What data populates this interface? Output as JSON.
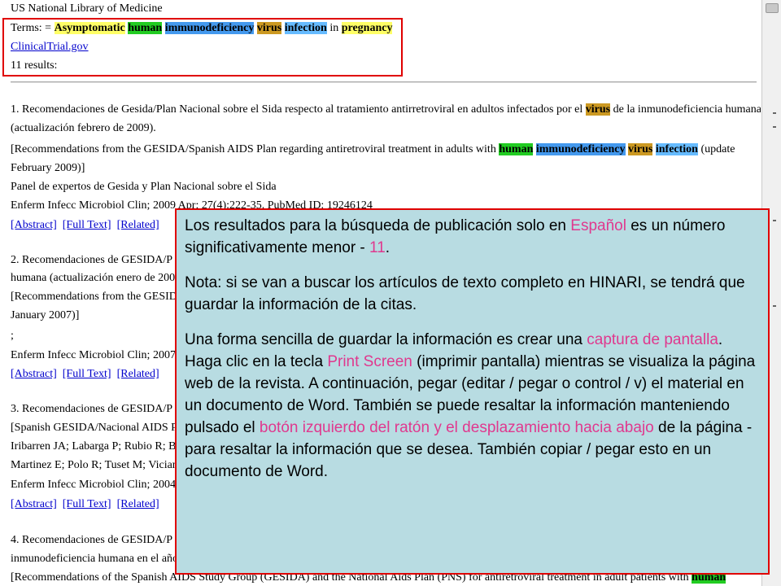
{
  "header": {
    "library": "US National Library of Medicine",
    "terms_prefix": "Terms: =",
    "terms": [
      "Asymptomatic",
      "human",
      "immunodeficiency",
      "virus",
      "infection"
    ],
    "terms_in": "in",
    "terms_pregnancy": "pregnancy",
    "source_link": "ClinicalTrial.gov",
    "results_count": "11 results:"
  },
  "colors": {
    "highlight_yellow": "#ffff66",
    "highlight_green": "#22cc22",
    "highlight_blue": "#4499ee",
    "highlight_orange": "#cc9922",
    "highlight_cyan": "#66bbff",
    "overlay_bg": "#b8dce2",
    "frame_red": "#e00000",
    "accent_pink": "#e0388e"
  },
  "results": [
    {
      "title_a": "1. Recomendaciones de Gesida/Plan Nacional sobre el Sida respecto al tratamiento antirretroviral en adultos infectados por el",
      "title_kw": "virus",
      "title_b": "de la inmunodeficiencia humana",
      "title_line2": "(actualización febrero de 2009).",
      "en_a": "[Recommendations from the GESIDA/Spanish AIDS Plan regarding antiretroviral treatment in adults with",
      "en_kw1": "human",
      "en_kw2": "immunodeficiency",
      "en_kw3": "virus",
      "en_kw4": "infection",
      "en_b": "(update",
      "en_line2": "February 2009)]",
      "authors": "Panel de expertos de Gesida y Plan Nacional sobre el Sida",
      "citation": "Enferm Infecc Microbiol Clin; 2009 Apr; 27(4):222-35. PubMed ID: 19246124",
      "links": [
        "[Abstract]",
        "[Full Text]",
        "[Related]"
      ]
    },
    {
      "title_line1": "2. Recomendaciones de GESIDA/P",
      "title_line2": "humana (actualización enero de 2007",
      "en_line1": "[Recommendations from the GESID",
      "en_line2": "January 2007)]",
      "authors": ";",
      "citation": "Enferm Infecc Microbiol Clin; 2007",
      "links": [
        "[Abstract]",
        "[Full Text]",
        "[Related]"
      ]
    },
    {
      "title_line1": "3. Recomendaciones de GESIDA/P",
      "en_line1": "[Spanish GESIDA/Nacional AIDS P",
      "authors1": "Iribarren JA; Labarga P; Rubio R; B",
      "authors2": "Martinez E; Polo R; Tuset M; Vician",
      "citation": "Enferm Infecc Microbiol Clin; 2004",
      "links": [
        "[Abstract]",
        "[Full Text]",
        "[Related]"
      ]
    },
    {
      "title_line1": "4. Recomendaciones de GESIDA/P",
      "title_line2": "inmunodeficiencia humana en el año",
      "en_a": "[Recommendations of the Spanish AIDS Study Group (GESIDA) and the National Aids Plan (PNS) for antiretroviral treatment in adult patients with",
      "en_kw": "human"
    }
  ],
  "overlay": {
    "p1_a": "Los resultados para la búsqueda de publicación solo en",
    "p1_pink1": "Español",
    "p1_b": "es un número significativamente menor -",
    "p1_pink2": "11",
    "p1_c": ".",
    "p2": "Nota: si se van a buscar los artículos de texto completo en HINARI, se tendrá que guardar la información de la citas.",
    "p3_a": "Una forma sencilla de guardar la información es crear una",
    "p3_pink1": "captura de pantalla",
    "p3_b": ". Haga clic en la tecla",
    "p3_pink2": "Print Screen",
    "p3_c": "(imprimir pantalla) mientras se visualiza la página web de la revista. A continuación, pegar (editar / pegar o control / v) el material en un documento de Word. También se puede resaltar la información manteniendo pulsado el",
    "p3_pink3": "botón izquierdo del ratón y el desplazamiento hacia abajo",
    "p3_d": "de la página - para resaltar la información que se desea. También copiar / pegar esto en un documento de Word."
  }
}
